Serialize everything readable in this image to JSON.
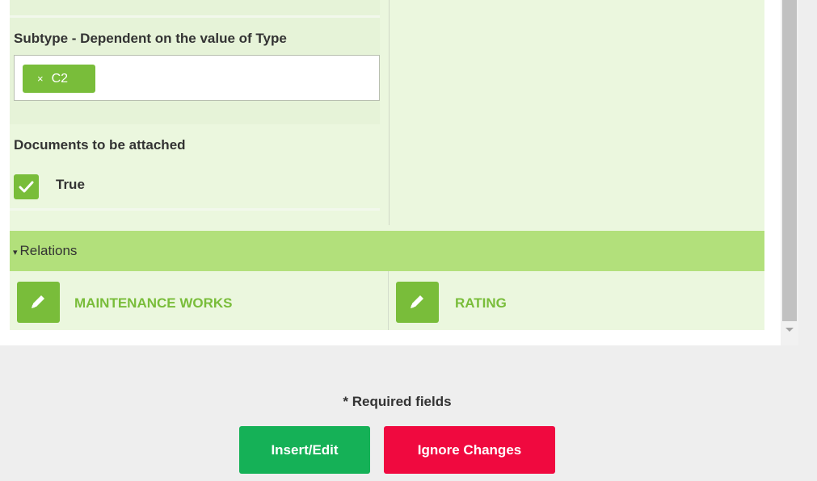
{
  "form": {
    "subtype_label": "Subtype - Dependent on the value of Type",
    "subtype_tags": [
      {
        "remove_symbol": "×",
        "label": "C2"
      }
    ],
    "documents_label": "Documents to be attached",
    "documents_checkbox": {
      "checked": true,
      "label": "True"
    }
  },
  "relations": {
    "caret": "▾",
    "header": "Relations",
    "items": [
      {
        "icon": "pencil-icon",
        "label": "MAINTENANCE WORKS"
      },
      {
        "icon": "pencil-icon",
        "label": "RATING"
      }
    ]
  },
  "footer": {
    "required_note": "* Required fields",
    "insert_label": "Insert/Edit",
    "ignore_label": "Ignore Changes"
  },
  "colors": {
    "accent_green": "#79bd3a",
    "relations_header": "#b2e07b",
    "form_background": "#ebf7de",
    "insert_button": "#15b157",
    "ignore_button": "#f0093f"
  }
}
